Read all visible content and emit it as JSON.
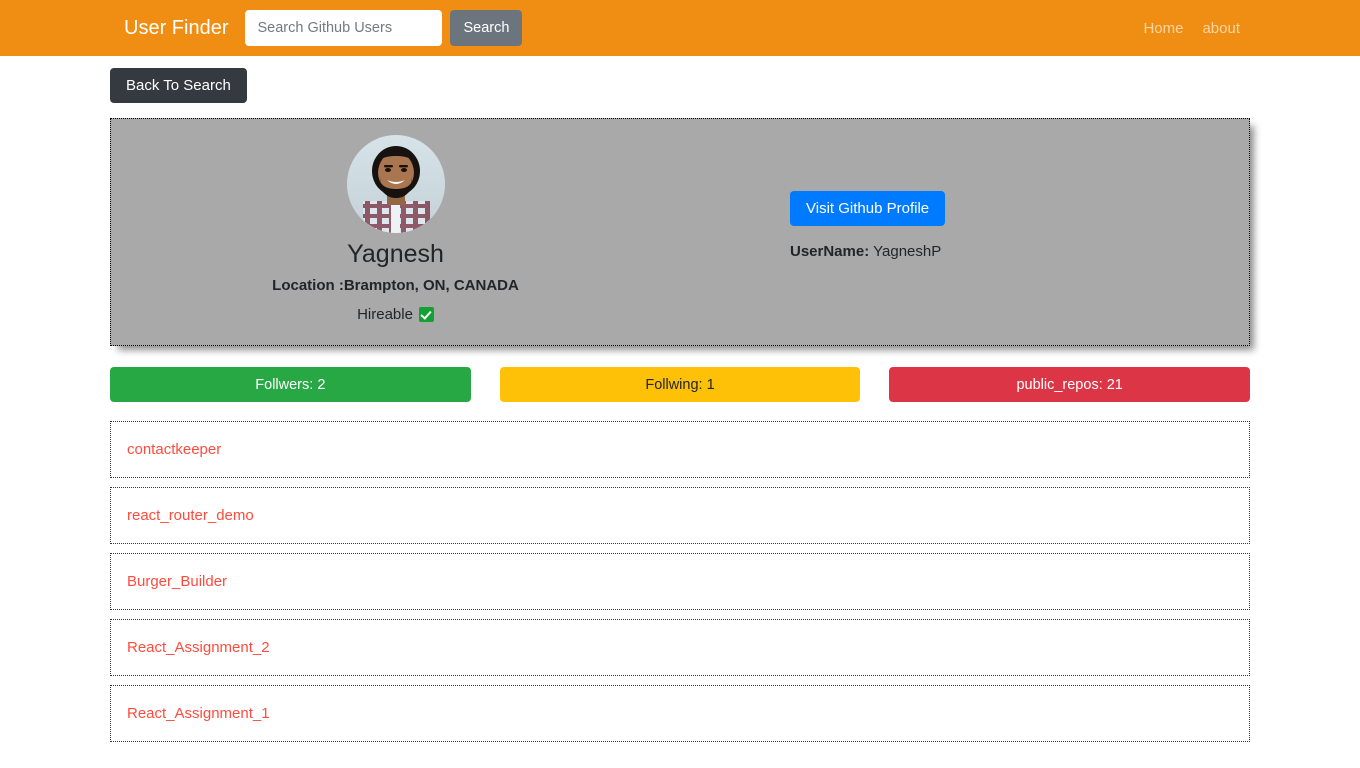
{
  "navbar": {
    "brand": "User Finder",
    "search": {
      "placeholder": "Search Github Users",
      "value": "",
      "button_label": "Search"
    },
    "links": [
      {
        "label": "Home"
      },
      {
        "label": "about"
      }
    ],
    "background_color": "#ef8e12"
  },
  "actions": {
    "back_to_search": "Back To Search"
  },
  "profile": {
    "name": "Yagnesh",
    "location": "Location :Brampton, ON, CANADA",
    "hireable_label": "Hireable",
    "hireable_icon": "green-check-badge-icon",
    "avatar_alt": "avatar",
    "visit_button": "Visit Github Profile",
    "username_label": "UserName:",
    "username_value": "YagneshP",
    "card_background": "#a9a9a9"
  },
  "stats": [
    {
      "label": "Follwers: 2",
      "color": "#28a745",
      "text_color": "#ffffff"
    },
    {
      "label": "Follwing: 1",
      "color": "#ffc107",
      "text_color": "#212529"
    },
    {
      "label": "public_repos: 21",
      "color": "#dc3545",
      "text_color": "#ffffff"
    }
  ],
  "repos": [
    {
      "name": "contactkeeper"
    },
    {
      "name": "react_router_demo"
    },
    {
      "name": "Burger_Builder"
    },
    {
      "name": "React_Assignment_2"
    },
    {
      "name": "React_Assignment_1"
    }
  ]
}
